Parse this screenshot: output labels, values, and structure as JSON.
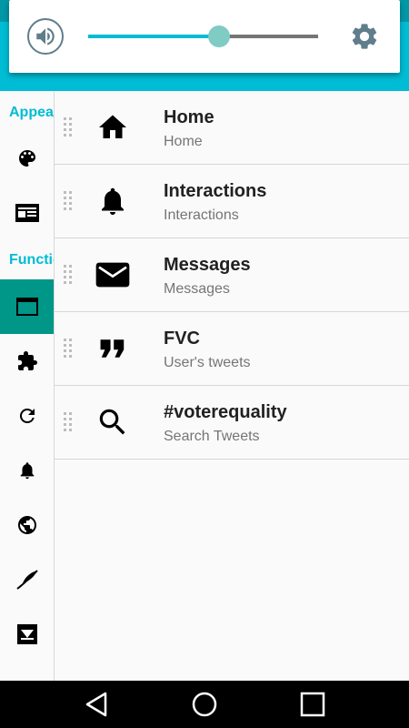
{
  "volume": {
    "level": 0.57,
    "accent": "#00bcd4",
    "thumb_color": "#80cbc4",
    "icon": "speaker-icon",
    "settings_icon": "gear-icon"
  },
  "sidebar": {
    "sections": [
      {
        "label": "Appearance"
      },
      {
        "label": "Functionality"
      }
    ],
    "items": [
      {
        "icon": "palette-icon"
      },
      {
        "icon": "article-icon"
      },
      {
        "icon": "browser-window-icon",
        "active": true
      },
      {
        "icon": "puzzle-icon"
      },
      {
        "icon": "refresh-icon"
      },
      {
        "icon": "bell-icon"
      },
      {
        "icon": "globe-icon"
      },
      {
        "icon": "feather-icon"
      },
      {
        "icon": "mailbox-icon"
      }
    ]
  },
  "tabs": [
    {
      "title": "Home",
      "subtitle": "Home",
      "icon": "home-icon"
    },
    {
      "title": "Interactions",
      "subtitle": "Interactions",
      "icon": "bell-icon"
    },
    {
      "title": "Messages",
      "subtitle": "Messages",
      "icon": "mail-icon"
    },
    {
      "title": "FVC",
      "subtitle": "User's tweets",
      "icon": "quote-icon"
    },
    {
      "title": "#voterequality",
      "subtitle": "Search Tweets",
      "icon": "search-icon"
    }
  ],
  "navbar": {
    "back_icon": "back-icon",
    "home_icon": "home-circle-icon",
    "recents_icon": "recents-icon"
  }
}
